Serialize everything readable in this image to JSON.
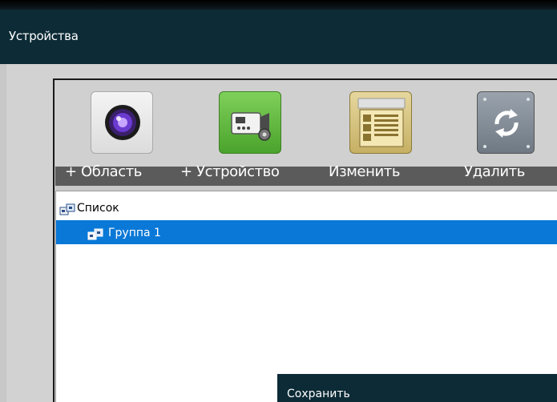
{
  "window": {
    "title": "Устройства"
  },
  "toolbar": {
    "items": [
      {
        "label": "+ Область",
        "icon": "camera-lens-icon"
      },
      {
        "label": "+ Устройство",
        "icon": "device-settings-icon"
      },
      {
        "label": "Изменить",
        "icon": "document-edit-icon"
      },
      {
        "label": "Удалить",
        "icon": "refresh-icon"
      }
    ]
  },
  "tree": {
    "root": {
      "label": "Список",
      "icon": "device-group-icon"
    },
    "children": [
      {
        "label": "Группа 1",
        "icon": "device-group-icon",
        "selected": true
      }
    ]
  },
  "footer": {
    "save_label": "Сохранить"
  },
  "colors": {
    "titlebar": "#0c2b36",
    "selection": "#0a78d7",
    "label_bar": "#5b5b5b"
  }
}
